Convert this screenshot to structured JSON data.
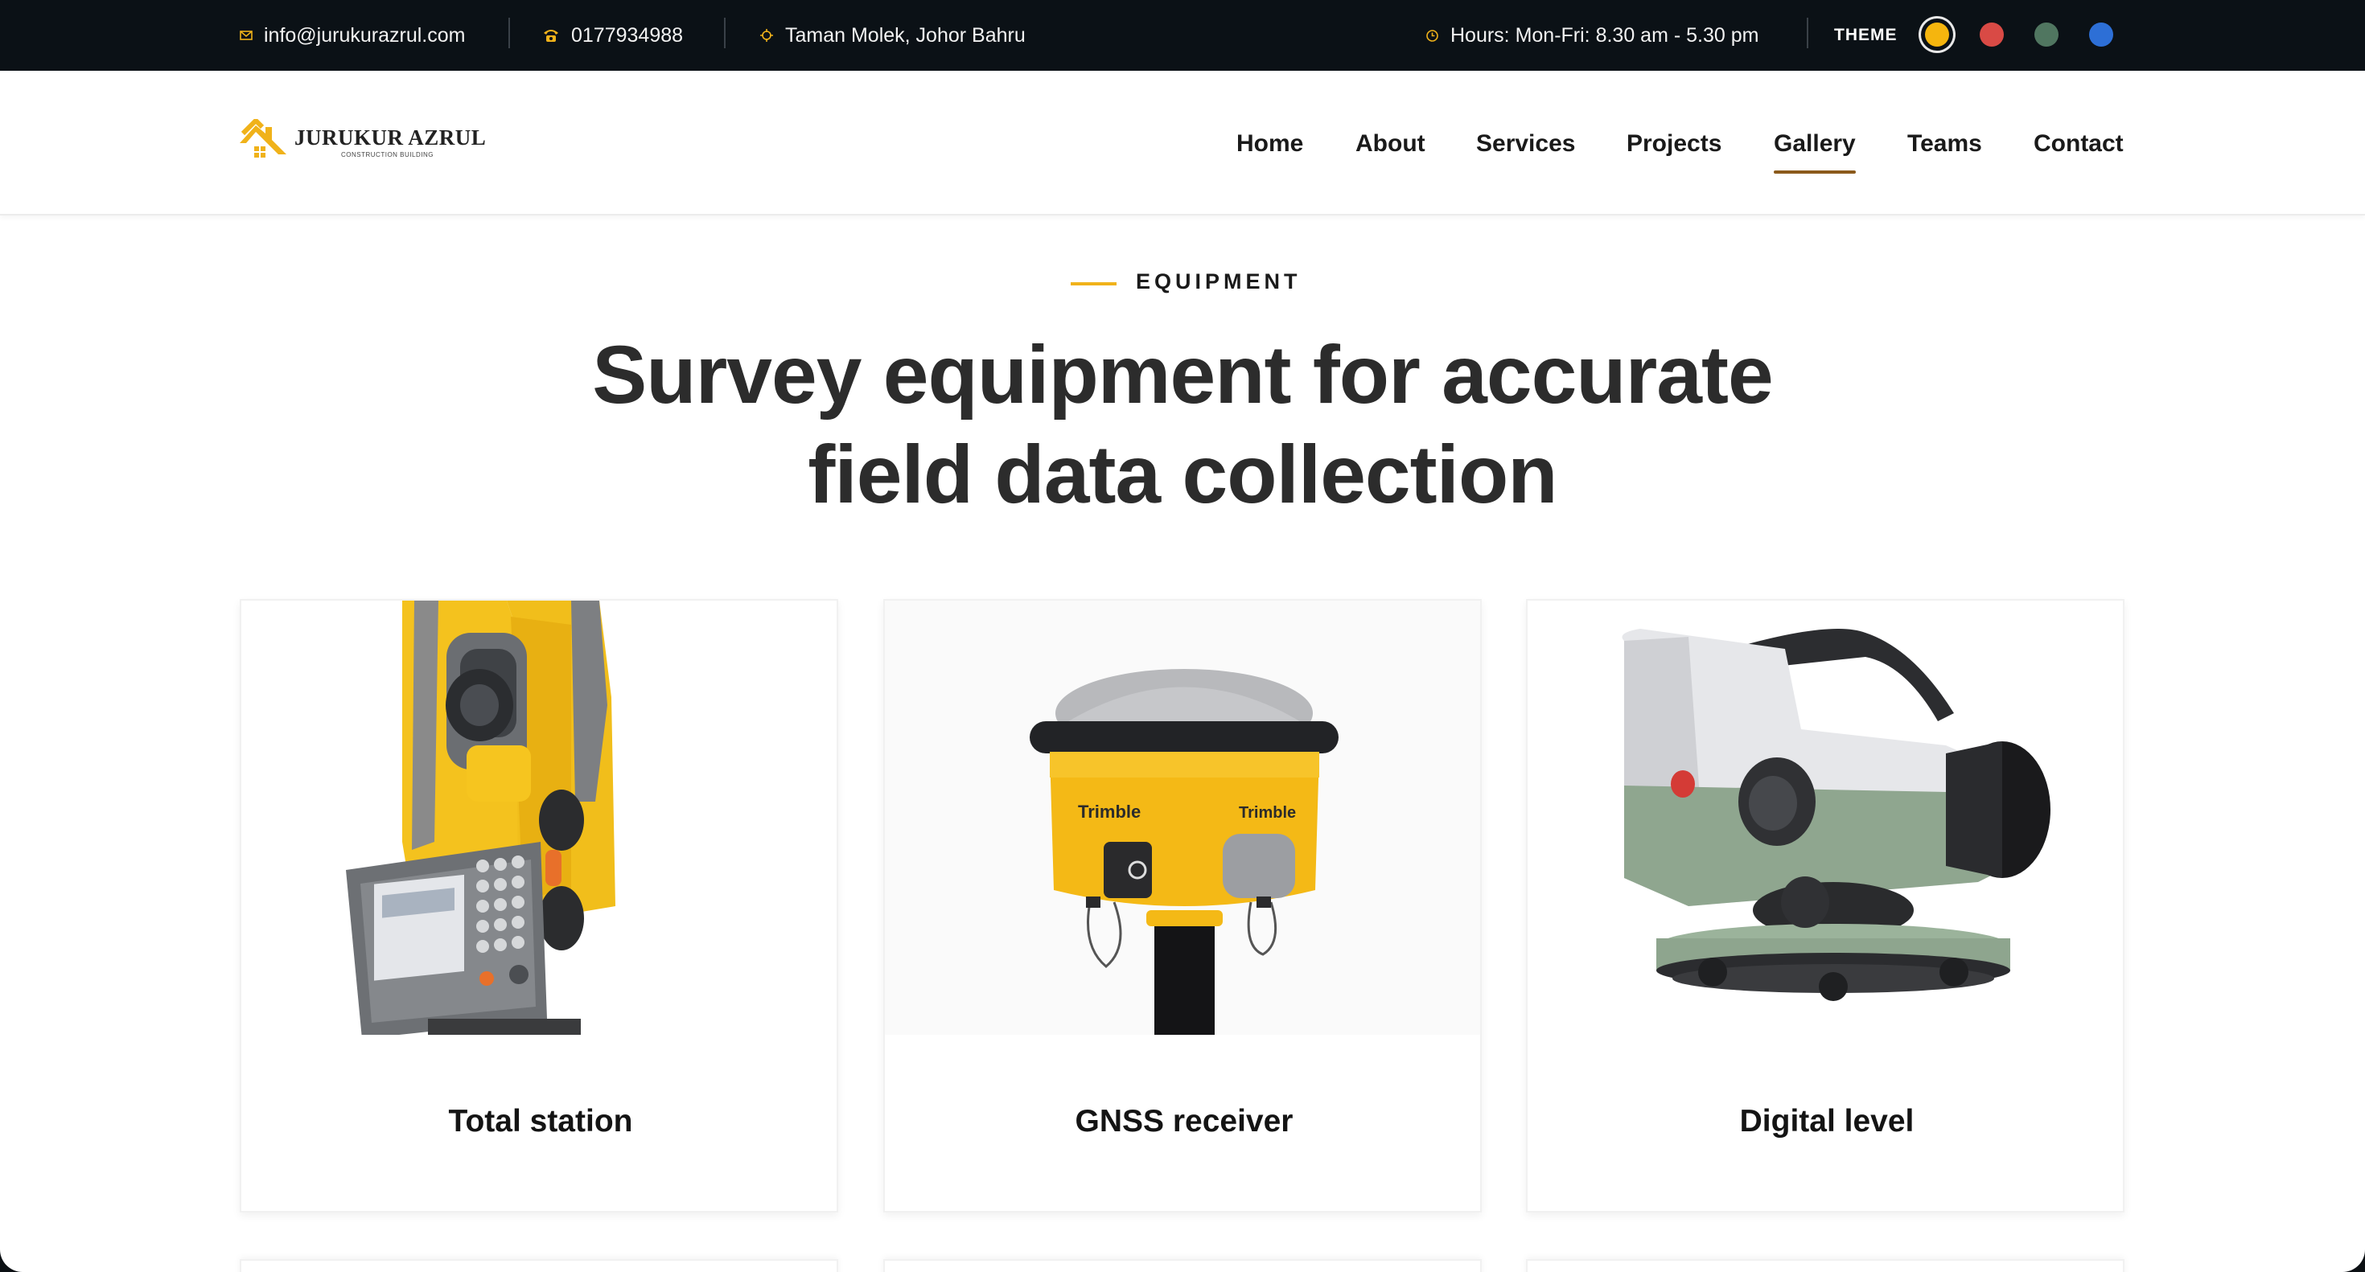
{
  "topbar": {
    "email": "info@jurukurazrul.com",
    "phone": "0177934988",
    "location": "Taman Molek, Johor Bahru",
    "hours": "Hours: Mon-Fri: 8.30 am - 5.30 pm",
    "theme_label": "THEME",
    "theme_colors": [
      {
        "name": "yellow",
        "color": "#f5b50e",
        "active": true
      },
      {
        "name": "red",
        "color": "#d94a45",
        "active": false
      },
      {
        "name": "green",
        "color": "#507660",
        "active": false
      },
      {
        "name": "blue",
        "color": "#2d6fd6",
        "active": false
      }
    ],
    "icons": [
      "mail-icon",
      "phone-icon",
      "location-icon",
      "clock-icon"
    ]
  },
  "header": {
    "logo_name": "JURUKUR AZRUL",
    "logo_sub": "CONSTRUCTION BUILDING",
    "nav": [
      "Home",
      "About",
      "Services",
      "Projects",
      "Gallery",
      "Teams",
      "Contact"
    ],
    "active_nav": "Gallery"
  },
  "section": {
    "eyebrow": "EQUIPMENT",
    "heading_line1": "Survey equipment for accurate",
    "heading_line2": "field data collection"
  },
  "cards": [
    {
      "title": "Total station",
      "image": "total-station-image"
    },
    {
      "title": "GNSS receiver",
      "image": "gnss-receiver-image"
    },
    {
      "title": "Digital level",
      "image": "digital-level-image"
    }
  ],
  "brand_marks": {
    "gnss_brand": "Trimble"
  },
  "colors": {
    "accent": "#f0b21a",
    "topbar_bg": "#0b1116",
    "nav_underline": "#8b5a1b",
    "heading": "#2c2c2c"
  }
}
